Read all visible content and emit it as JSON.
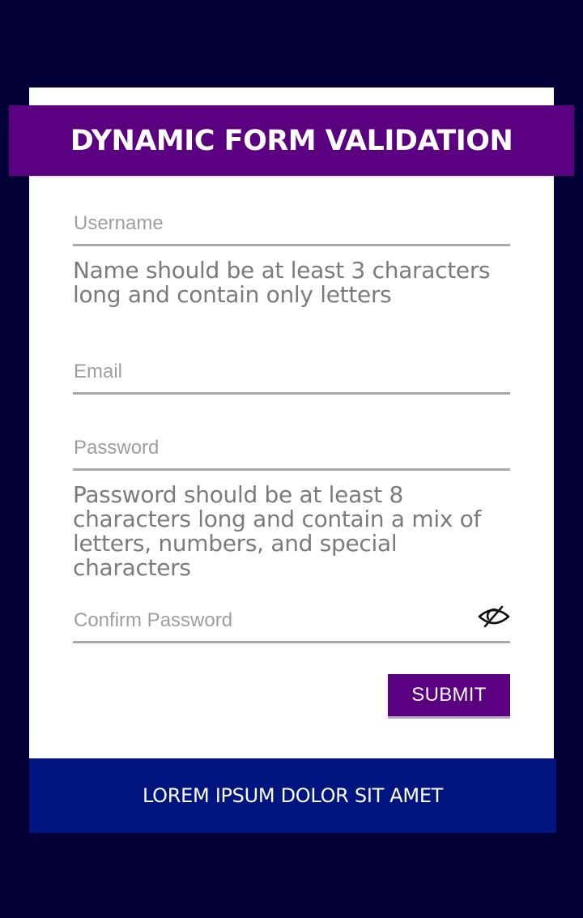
{
  "header": {
    "title": "DYNAMIC FORM VALIDATION"
  },
  "form": {
    "username": {
      "placeholder": "Username",
      "value": "",
      "error": "Name should be at least 3 characters long and contain only letters"
    },
    "email": {
      "placeholder": "Email",
      "value": ""
    },
    "password": {
      "placeholder": "Password",
      "value": "",
      "error": "Password should be at least 8 characters long and contain a mix of letters, numbers, and special characters"
    },
    "confirm_password": {
      "placeholder": "Confirm Password",
      "value": "",
      "toggle_icon": "eye-slash-icon"
    },
    "submit_label": "SUBMIT"
  },
  "footer": {
    "text": "LOREM IPSUM DOLOR SIT AMET"
  },
  "colors": {
    "background": "#020036",
    "card": "#ffffff",
    "accent_purple": "#5a0080",
    "footer_blue": "#001580",
    "input_border": "#a9a9a9",
    "error_text": "#7b7b7b"
  }
}
